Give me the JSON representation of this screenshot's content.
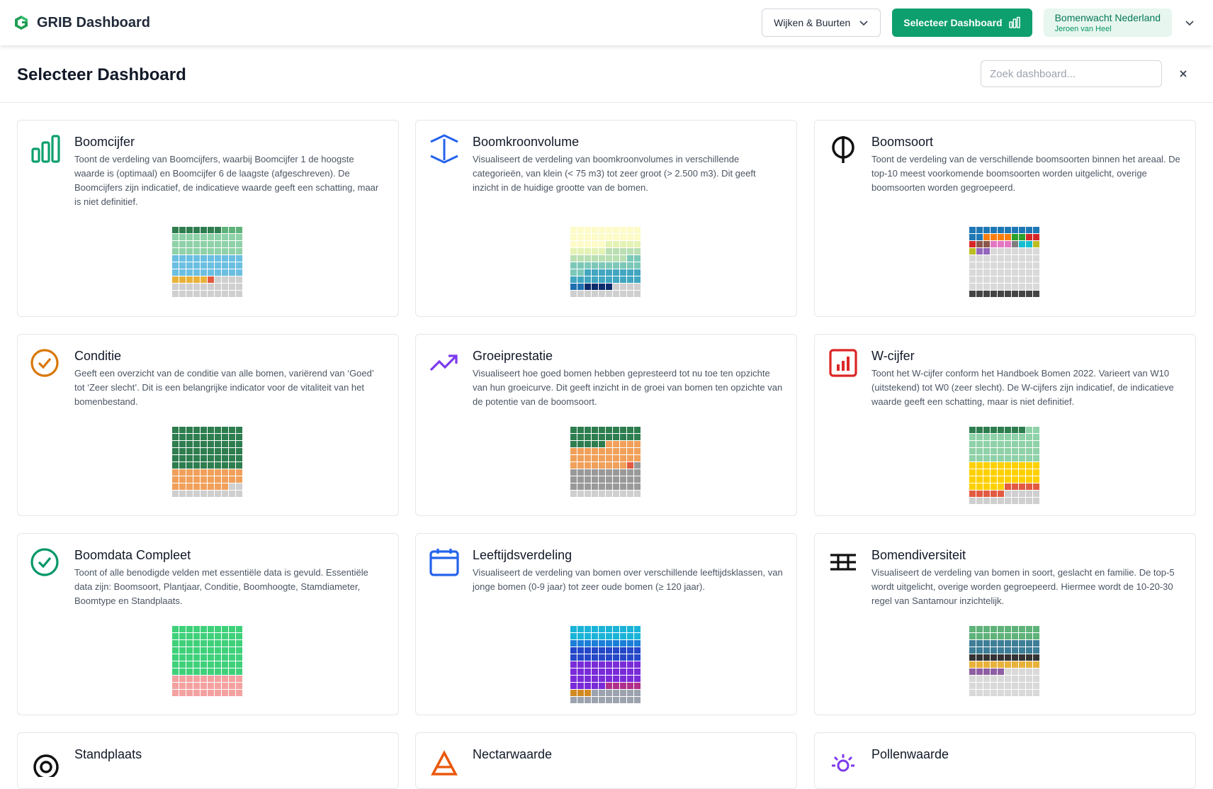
{
  "topbar": {
    "title": "GRIB Dashboard",
    "area_select": "Wijken & Buurten",
    "select_dashboard": "Selecteer Dashboard",
    "org_name": "Bomenwacht Nederland",
    "user_name": "Jeroen van Heel"
  },
  "header": {
    "title": "Selecteer Dashboard",
    "search_placeholder": "Zoek dashboard..."
  },
  "cards": [
    {
      "title": "Boomcijfer",
      "icon": "bar-chart-icon",
      "description": "Toont de verdeling van Boomcijfers, waarbij Boomcijfer 1 de hoogste waarde is (optimaal) en Boomcijfer 6 de laagste (afgeschreven). De Boomcijfers zijn indicatief, de indicatieve waarde geeft een schatting, maar is niet definitief."
    },
    {
      "title": "Boomkroonvolume",
      "icon": "crown-volume-icon",
      "description": "Visualiseert de verdeling van boomkroonvolumes in verschillende categorieën, van klein (< 75 m3) tot zeer groot (> 2.500 m3). Dit geeft inzicht in de huidige grootte van de bomen."
    },
    {
      "title": "Boomsoort",
      "icon": "phi-icon",
      "description": "Toont de verdeling van de verschillende boomsoorten binnen het areaal. De top-10 meest voorkomende boomsoorten worden uitgelicht, overige boomsoorten worden gegroepeerd."
    },
    {
      "title": "Conditie",
      "icon": "check-circle-orange-icon",
      "description": "Geeft een overzicht van de conditie van alle bomen, variërend van ‘Goed’ tot ‘Zeer slecht’. Dit is een belangrijke indicator voor de vitaliteit van het bomenbestand."
    },
    {
      "title": "Groeiprestatie",
      "icon": "trending-up-icon",
      "description": "Visualiseert hoe goed bomen hebben gepresteerd tot nu toe ten opzichte van hun groeicurve. Dit geeft inzicht in de groei van bomen ten opzichte van de potentie van de boomsoort."
    },
    {
      "title": "W-cijfer",
      "icon": "report-chart-icon",
      "description": "Toont het W-cijfer conform het Handboek Bomen 2022. Varieert van W10 (uitstekend) tot W0 (zeer slecht). De W-cijfers zijn indicatief, de indicatieve waarde geeft een schatting, maar is niet definitief."
    },
    {
      "title": "Boomdata Compleet",
      "icon": "check-circle-green-icon",
      "description": "Toont of alle benodigde velden met essentiële data is gevuld. Essentiële data zijn: Boomsoort, Plantjaar, Conditie, Boomhoogte, Stamdiameter, Boomtype en Standplaats."
    },
    {
      "title": "Leeftijdsverdeling",
      "icon": "calendar-icon",
      "description": "Visualiseert de verdeling van bomen over verschillende leeftijdsklassen, van jonge bomen (0-9 jaar) tot zeer oude bomen (≥ 120 jaar)."
    },
    {
      "title": "Bomendiversiteit",
      "icon": "diversity-icon",
      "description": "Visualiseert de verdeling van bomen in soort, geslacht en familie. De top-5 wordt uitgelicht, overige worden gegroepeerd. Hiermee wordt de 10-20-30 regel van Santamour inzichtelijk."
    },
    {
      "title": "Standplaats",
      "icon": "target-icon",
      "description": ""
    },
    {
      "title": "Nectarwaarde",
      "icon": "nectar-icon",
      "description": ""
    },
    {
      "title": "Pollenwaarde",
      "icon": "sun-icon",
      "description": ""
    }
  ],
  "waffles": [
    [
      [
        "#2e7d4f",
        7
      ],
      [
        "#5fb27a",
        3
      ],
      [
        "#8fd1a8",
        30
      ],
      [
        "#6bbfe0",
        30
      ],
      [
        "#e8b23a",
        5
      ],
      [
        "#e25a41",
        1
      ],
      [
        "#cfcfcf",
        24
      ]
    ],
    [
      [
        "#fdfbc8",
        25
      ],
      [
        "#e4f2b5",
        10
      ],
      [
        "#b9dfb3",
        13
      ],
      [
        "#7cc8b8",
        14
      ],
      [
        "#41a6c0",
        18
      ],
      [
        "#1f6fb0",
        2
      ],
      [
        "#0c2c6b",
        4
      ],
      [
        "#cfcfcf",
        14
      ]
    ],
    [
      [
        "#1f77b4",
        10
      ],
      [
        "#1f77b4",
        2
      ],
      [
        "#ff7f0e",
        4
      ],
      [
        "#2ca02c",
        2
      ],
      [
        "#d62728",
        3
      ],
      [
        "#8c564b",
        2
      ],
      [
        "#e377c2",
        3
      ],
      [
        "#7f7f7f",
        1
      ],
      [
        "#17becf",
        2
      ],
      [
        "#bcbd22",
        2
      ],
      [
        "#9467bd",
        2
      ],
      [
        "#d9d9d9",
        57
      ],
      [
        "#444444",
        10
      ]
    ],
    [
      [
        "#2e7d4f",
        60
      ],
      [
        "#f0a05a",
        28
      ],
      [
        "#cfcfcf",
        12
      ]
    ],
    [
      [
        "#2e7d4f",
        25
      ],
      [
        "#f0a05a",
        33
      ],
      [
        "#e25a41",
        1
      ],
      [
        "#999999",
        31
      ],
      [
        "#cfcfcf",
        10
      ]
    ],
    [
      [
        "#2e7d4f",
        8
      ],
      [
        "#8fd1a8",
        42
      ],
      [
        "#ffd000",
        35
      ],
      [
        "#e25a41",
        10
      ],
      [
        "#cfcfcf",
        15
      ]
    ],
    [
      [
        "#3fd07a",
        70
      ],
      [
        "#f4a1a1",
        30
      ]
    ],
    [
      [
        "#1bb4d8",
        20
      ],
      [
        "#1b7fd8",
        10
      ],
      [
        "#2548c8",
        20
      ],
      [
        "#7a2bd8",
        35
      ],
      [
        "#b0308a",
        5
      ],
      [
        "#d28a20",
        3
      ],
      [
        "#9ca3af",
        17
      ]
    ],
    [
      [
        "#5fb27a",
        20
      ],
      [
        "#3d7d96",
        20
      ],
      [
        "#333333",
        10
      ],
      [
        "#e8b23a",
        10
      ],
      [
        "#8e5ea2",
        5
      ],
      [
        "#d9d9d9",
        35
      ]
    ],
    [],
    [],
    []
  ]
}
